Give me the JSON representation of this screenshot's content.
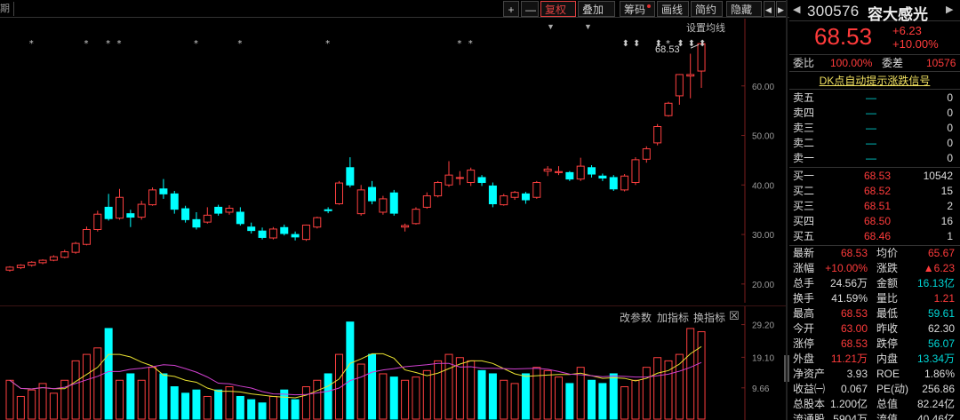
{
  "toolbar": {
    "left_label": "期",
    "buttons": [
      {
        "id": "plus",
        "label": "+"
      },
      {
        "id": "minus",
        "label": "—"
      },
      {
        "id": "fuquan",
        "label": "复权",
        "caret": "▼",
        "active": true
      },
      {
        "id": "diejia",
        "label": "叠加",
        "caret": "▼"
      },
      {
        "id": "chouma",
        "label": "筹码",
        "dot": true
      },
      {
        "id": "huaxian",
        "label": "画线"
      },
      {
        "id": "jianyue",
        "label": "简约"
      },
      {
        "id": "yincang",
        "label": "隐藏"
      },
      {
        "id": "prev",
        "label": "◀"
      },
      {
        "id": "next",
        "label": "▶"
      }
    ]
  },
  "kline": {
    "ma_setting_label": "设置均线",
    "max_label": "68.53",
    "y_ticks": [
      "60.00",
      "50.00",
      "40.00",
      "30.00",
      "20.00"
    ]
  },
  "volume": {
    "links": [
      "改参数",
      "加指标",
      "换指标"
    ],
    "close_label": "☒",
    "y_ticks": [
      "29.20",
      "19.10",
      "9.66"
    ]
  },
  "chart_data": {
    "type": "candlestick",
    "ylim": [
      18,
      70
    ],
    "ohlc": [
      [
        22.8,
        23.6,
        22.5,
        23.4
      ],
      [
        23.3,
        24.0,
        23.0,
        23.8
      ],
      [
        23.8,
        24.6,
        23.5,
        24.4
      ],
      [
        24.3,
        25.0,
        24.0,
        24.8
      ],
      [
        24.8,
        25.8,
        24.6,
        25.5
      ],
      [
        25.4,
        26.9,
        25.2,
        26.5
      ],
      [
        26.4,
        28.5,
        26.1,
        28.2
      ],
      [
        28.0,
        31.6,
        27.8,
        31.0
      ],
      [
        31.0,
        34.8,
        30.6,
        34.1
      ],
      [
        35.5,
        38.2,
        32.8,
        33.2
      ],
      [
        33.3,
        39.2,
        33.0,
        37.5
      ],
      [
        34.2,
        35.0,
        31.5,
        33.5
      ],
      [
        33.5,
        36.8,
        33.0,
        36.1
      ],
      [
        36.0,
        39.5,
        35.8,
        39.0
      ],
      [
        39.2,
        41.2,
        37.2,
        38.2
      ],
      [
        38.2,
        38.8,
        34.2,
        35.1
      ],
      [
        35.2,
        35.8,
        32.4,
        33.0
      ],
      [
        33.0,
        34.5,
        31.0,
        31.5
      ],
      [
        32.5,
        35.5,
        32.2,
        33.9
      ],
      [
        35.5,
        36.0,
        33.8,
        34.3
      ],
      [
        34.5,
        35.9,
        34.0,
        35.3
      ],
      [
        34.5,
        35.5,
        31.8,
        32.2
      ],
      [
        31.5,
        32.4,
        30.2,
        30.8
      ],
      [
        30.7,
        31.4,
        29.0,
        29.4
      ],
      [
        29.3,
        31.5,
        29.0,
        31.1
      ],
      [
        31.4,
        32.0,
        29.8,
        30.2
      ],
      [
        30.0,
        30.6,
        28.8,
        29.5
      ],
      [
        29.0,
        32.0,
        28.7,
        31.9
      ],
      [
        31.5,
        33.6,
        31.2,
        33.4
      ],
      [
        35.0,
        35.5,
        34.3,
        34.8
      ],
      [
        36.2,
        40.8,
        36.0,
        40.4
      ],
      [
        43.5,
        45.6,
        39.5,
        40.0
      ],
      [
        34.2,
        40.0,
        33.8,
        39.0
      ],
      [
        39.5,
        40.8,
        36.1,
        36.8
      ],
      [
        34.5,
        37.8,
        34.0,
        37.2
      ],
      [
        38.4,
        39.0,
        33.8,
        34.3
      ],
      [
        31.5,
        32.2,
        30.6,
        31.8
      ],
      [
        32.2,
        35.5,
        32.0,
        35.1
      ],
      [
        35.5,
        38.5,
        35.2,
        37.8
      ],
      [
        37.8,
        40.8,
        37.5,
        40.5
      ],
      [
        40.0,
        44.8,
        39.6,
        42.0
      ],
      [
        41.5,
        42.8,
        40.0,
        41.5
      ],
      [
        40.5,
        43.5,
        39.8,
        43.0
      ],
      [
        41.5,
        42.0,
        39.8,
        40.5
      ],
      [
        39.8,
        40.5,
        35.5,
        36.2
      ],
      [
        36.0,
        38.2,
        35.8,
        37.8
      ],
      [
        37.5,
        38.8,
        37.0,
        38.5
      ],
      [
        38.2,
        38.6,
        36.2,
        37.0
      ],
      [
        37.5,
        40.8,
        37.2,
        40.5
      ],
      [
        42.8,
        43.8,
        41.8,
        43.2
      ],
      [
        42.5,
        43.8,
        42.0,
        42.7
      ],
      [
        42.5,
        42.8,
        40.8,
        41.2
      ],
      [
        41.2,
        45.5,
        40.8,
        43.8
      ],
      [
        43.5,
        44.0,
        41.5,
        42.2
      ],
      [
        41.8,
        42.3,
        40.8,
        41.4
      ],
      [
        41.5,
        42.0,
        38.8,
        39.2
      ],
      [
        39.0,
        42.2,
        38.7,
        41.8
      ],
      [
        40.5,
        45.6,
        40.0,
        45.1
      ],
      [
        45.2,
        47.8,
        44.5,
        47.3
      ],
      [
        48.5,
        52.3,
        48.0,
        51.8
      ],
      [
        54.0,
        56.8,
        53.8,
        56.5
      ],
      [
        58.0,
        62.4,
        56.2,
        62.3
      ],
      [
        62.0,
        66.5,
        57.5,
        62.3
      ],
      [
        63.0,
        68.53,
        59.61,
        68.53
      ]
    ],
    "volume": [
      12,
      7,
      9,
      11,
      8,
      12,
      18,
      20,
      22,
      28,
      12,
      14,
      12,
      16,
      14,
      10,
      8,
      9,
      7,
      9,
      10,
      7,
      6,
      5,
      7,
      9,
      6,
      10,
      12,
      14,
      20,
      30,
      17,
      20,
      14,
      13,
      12,
      13,
      15,
      18,
      20,
      19,
      18,
      15,
      14,
      12,
      11,
      14,
      16,
      15,
      13,
      11,
      16,
      12,
      11,
      14,
      10,
      12,
      16,
      19,
      18,
      20,
      28,
      27
    ],
    "vol_ylim": [
      0,
      31
    ]
  },
  "quote": {
    "code": "300576",
    "name": "容大感光",
    "price": "68.53",
    "change": "+6.23",
    "change_pct": "+10.00%",
    "weibi_label": "委比",
    "weibi": "100.00%",
    "weicha_label": "委差",
    "weicha": "10576",
    "signal_link": "DK点自动提示涨跌信号",
    "asks": [
      {
        "label": "卖五",
        "price": "—",
        "vol": "0"
      },
      {
        "label": "卖四",
        "price": "—",
        "vol": "0"
      },
      {
        "label": "卖三",
        "price": "—",
        "vol": "0"
      },
      {
        "label": "卖二",
        "price": "—",
        "vol": "0"
      },
      {
        "label": "卖一",
        "price": "—",
        "vol": "0"
      }
    ],
    "bids": [
      {
        "label": "买一",
        "price": "68.53",
        "vol": "10542"
      },
      {
        "label": "买二",
        "price": "68.52",
        "vol": "15"
      },
      {
        "label": "买三",
        "price": "68.51",
        "vol": "2"
      },
      {
        "label": "买四",
        "price": "68.50",
        "vol": "16"
      },
      {
        "label": "买五",
        "price": "68.46",
        "vol": "1"
      }
    ],
    "stats": [
      [
        {
          "l": "最新",
          "v": "68.53",
          "c": "red"
        },
        {
          "l": "均价",
          "v": "65.67",
          "c": "red"
        }
      ],
      [
        {
          "l": "涨幅",
          "v": "+10.00%",
          "c": "red"
        },
        {
          "l": "涨跌",
          "v": "▲6.23",
          "c": "red"
        }
      ],
      [
        {
          "l": "总手",
          "v": "24.56万",
          "c": "white"
        },
        {
          "l": "金额",
          "v": "16.13亿",
          "c": "green"
        }
      ],
      [
        {
          "l": "换手",
          "v": "41.59%",
          "c": "white"
        },
        {
          "l": "量比",
          "v": "1.21",
          "c": "red"
        }
      ],
      [
        {
          "l": "最高",
          "v": "68.53",
          "c": "red"
        },
        {
          "l": "最低",
          "v": "59.61",
          "c": "green"
        }
      ],
      [
        {
          "l": "今开",
          "v": "63.00",
          "c": "red"
        },
        {
          "l": "昨收",
          "v": "62.30",
          "c": "white"
        }
      ],
      [
        {
          "l": "涨停",
          "v": "68.53",
          "c": "red"
        },
        {
          "l": "跌停",
          "v": "56.07",
          "c": "green"
        }
      ],
      [
        {
          "l": "外盘",
          "v": "11.21万",
          "c": "red"
        },
        {
          "l": "内盘",
          "v": "13.34万",
          "c": "green"
        }
      ],
      [
        {
          "l": "净资产",
          "v": "3.93",
          "c": "white"
        },
        {
          "l": "ROE",
          "v": "1.86%",
          "c": "white"
        }
      ],
      [
        {
          "l": "收益㈠",
          "v": "0.067",
          "c": "white"
        },
        {
          "l": "PE(动)",
          "v": "256.86",
          "c": "white"
        }
      ],
      [
        {
          "l": "总股本",
          "v": "1.200亿",
          "c": "white"
        },
        {
          "l": "总值",
          "v": "82.24亿",
          "c": "white"
        }
      ],
      [
        {
          "l": "流通股",
          "v": "5904万",
          "c": "white"
        },
        {
          "l": "流值",
          "v": "40.46亿",
          "c": "white"
        }
      ]
    ]
  },
  "colors": {
    "up": "#ff4040",
    "down": "#00ffff",
    "ma_yellow": "#e8e030",
    "ma_purple": "#d040d0"
  }
}
